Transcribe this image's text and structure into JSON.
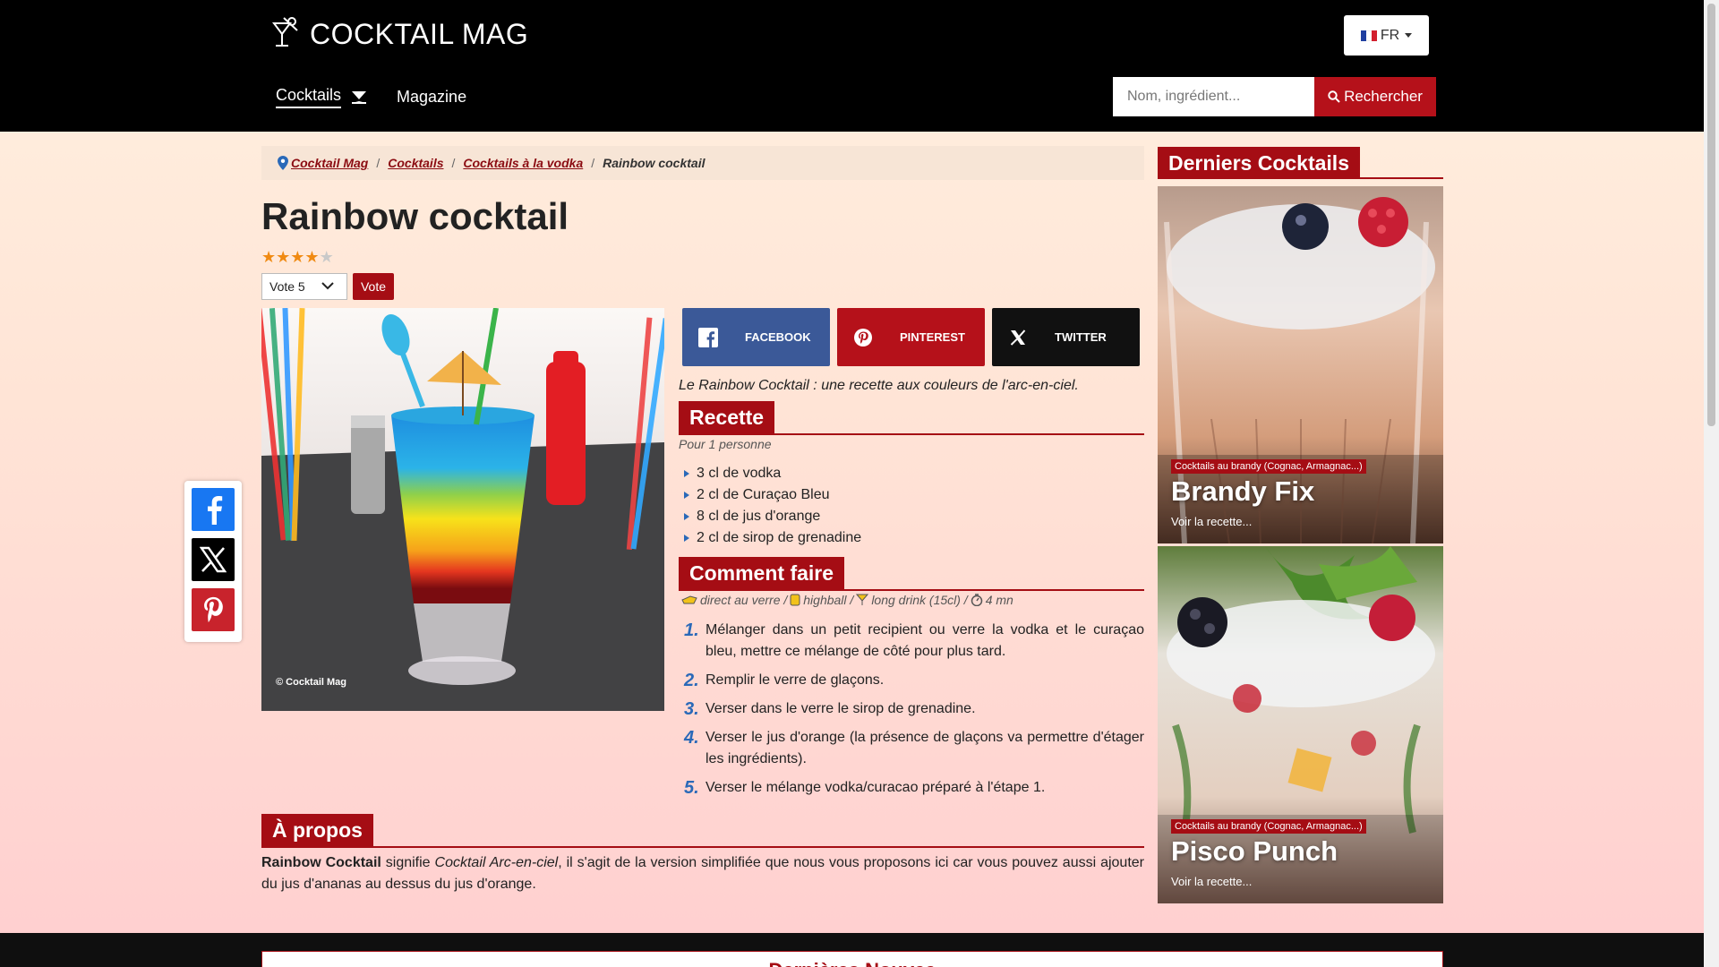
{
  "header": {
    "brand": "COCKTAIL MAG",
    "lang_label": "FR",
    "nav": [
      {
        "label": "Cocktails"
      },
      {
        "label": "Magazine"
      }
    ],
    "search_placeholder": "Nom, ingrédient...",
    "search_button": "Rechercher"
  },
  "breadcrumb": [
    "Cocktail Mag",
    "Cocktails",
    "Cocktails à la vodka",
    "Rainbow cocktail"
  ],
  "recipe": {
    "title": "Rainbow cocktail",
    "rating": 4,
    "rating_max": 5,
    "vote_select": "Vote 5",
    "vote_button": "Vote",
    "photo_credit": "© Cocktail Mag",
    "share": {
      "facebook": "FACEBOOK",
      "pinterest": "PINTEREST",
      "twitter": "TWITTER"
    },
    "intro": "Le Rainbow Cocktail : une recette aux couleurs de l'arc-en-ciel.",
    "recipe_heading": "Recette",
    "servings": "Pour 1 personne",
    "ingredients": [
      "3 cl de vodka",
      "2 cl de Curaçao Bleu",
      "8 cl de jus d'orange",
      "2 cl de sirop de grenadine"
    ],
    "howto_heading": "Comment faire",
    "meta": {
      "method": "direct au verre",
      "glass": "highball",
      "type": "long drink (15cl)",
      "time": "4 mn"
    },
    "steps": [
      {
        "n": "1.",
        "text": "Mélanger dans un petit recipient ou verre la vodka et le curaçao bleu, mettre ce mélange de côté pour plus tard."
      },
      {
        "n": "2.",
        "text": "Remplir le verre de glaçons."
      },
      {
        "n": "3.",
        "text": "Verser dans le verre le sirop de grenadine."
      },
      {
        "n": "4.",
        "text": "Verser le jus d'orange (la présence de glaçons va permettre d'étager les ingrédients)."
      },
      {
        "n": "5.",
        "text": "Verser le mélange vodka/curacao préparé à l'étape 1."
      }
    ],
    "about_heading": "À propos",
    "about": {
      "bold": "Rainbow Cocktail",
      "t1": " signifie ",
      "italic": "Cocktail Arc-en-ciel",
      "t2": ", il s'agit de la version simplifiée que nous vous proposons ici car vous pouvez aussi ajouter du jus d'ananas au dessus du jus d'orange."
    }
  },
  "sidebar": {
    "heading": "Derniers Cocktails",
    "cards": [
      {
        "category": "Cocktails au brandy (Cognac, Armagnac...)",
        "title": "Brandy Fix",
        "more": "Voir la recette..."
      },
      {
        "category": "Cocktails au brandy (Cognac, Armagnac...)",
        "title": "Pisco Punch",
        "more": "Voir la recette..."
      }
    ]
  },
  "footer": {
    "heading": "Dernières Nouvea"
  },
  "colors": {
    "accent": "#a50d14",
    "link_blue": "#2a69b8",
    "header_bg": "#000000",
    "facebook": "#3b5998"
  }
}
